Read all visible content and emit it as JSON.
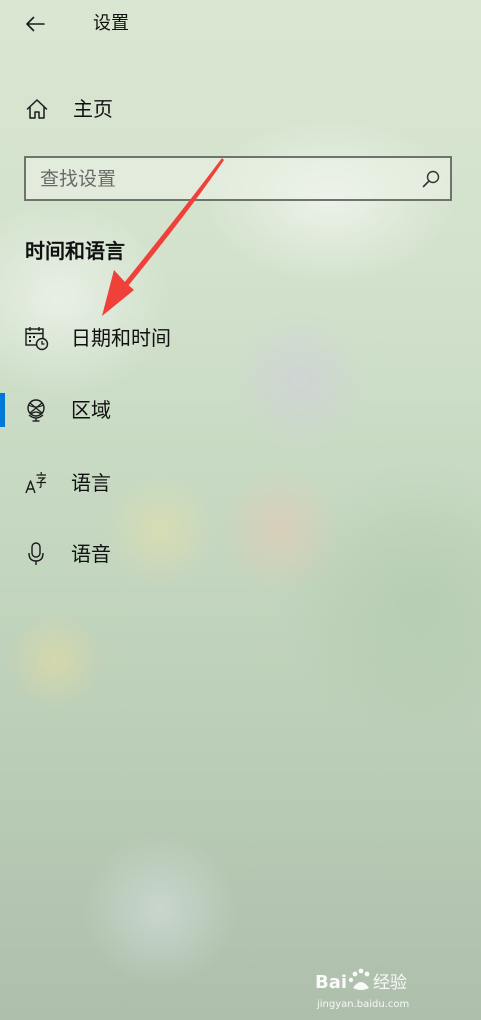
{
  "header": {
    "title": "设置",
    "back_icon": "back-arrow-icon"
  },
  "home": {
    "label": "主页",
    "icon": "home-icon"
  },
  "search": {
    "placeholder": "查找设置",
    "value": "",
    "icon": "search-icon"
  },
  "section": {
    "title": "时间和语言"
  },
  "nav": {
    "items": [
      {
        "label": "日期和时间",
        "icon": "calendar-clock-icon",
        "active": false
      },
      {
        "label": "区域",
        "icon": "globe-icon",
        "active": true
      },
      {
        "label": "语言",
        "icon": "language-icon",
        "active": false
      },
      {
        "label": "语音",
        "icon": "microphone-icon",
        "active": false
      }
    ]
  },
  "colors": {
    "accent": "#0078d7",
    "annotation": "#f0403a"
  },
  "watermark": {
    "brand": "Bai经验",
    "url": "jingyan.baidu.com"
  }
}
